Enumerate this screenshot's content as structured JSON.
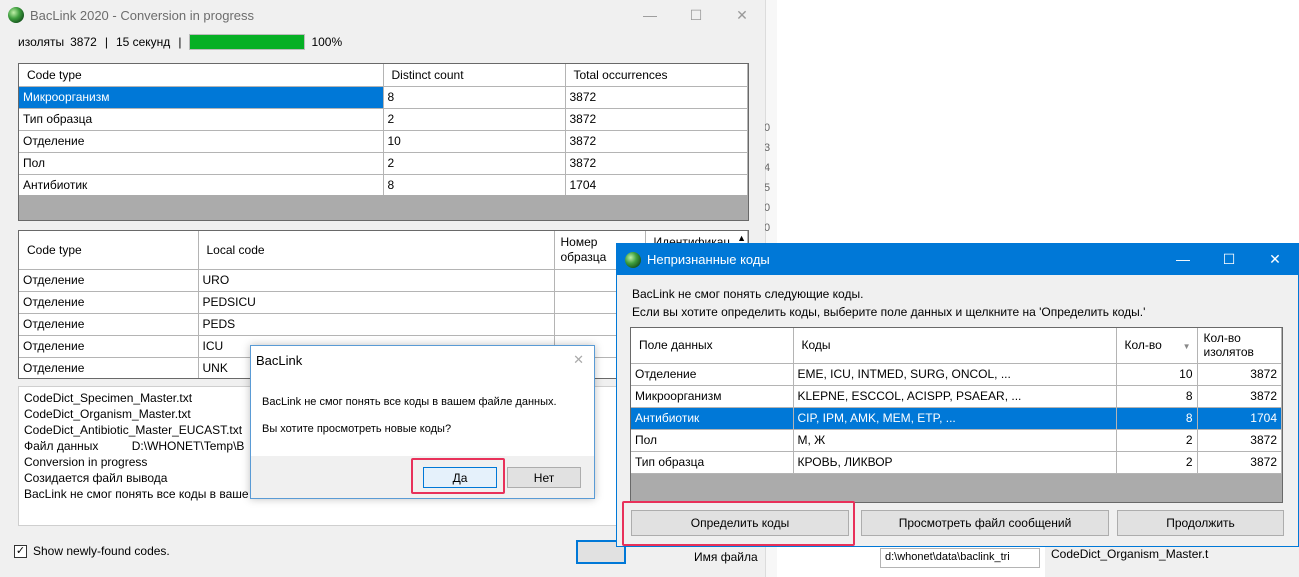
{
  "main": {
    "title": "BacLink 2020 - Conversion in progress",
    "status": {
      "isolates_label": "изоляты",
      "isolates_count": "3872",
      "sep1": "|",
      "time": "15 секунд",
      "sep2": "|",
      "progress": 100,
      "progress_text": "100%"
    },
    "summary_table": {
      "headers": [
        "Code type",
        "Distinct count",
        "Total occurrences"
      ],
      "rows": [
        [
          "Микроорганизм",
          "8",
          "3872"
        ],
        [
          "Тип образца",
          "2",
          "3872"
        ],
        [
          "Отделение",
          "10",
          "3872"
        ],
        [
          "Пол",
          "2",
          "3872"
        ],
        [
          "Антибиотик",
          "8",
          "1704"
        ]
      ]
    },
    "codes_table": {
      "headers": [
        "Code type",
        "Local code",
        "Номер образца",
        "Идентификац"
      ],
      "rows": [
        [
          "Отделение",
          "URO"
        ],
        [
          "Отделение",
          "PEDSICU"
        ],
        [
          "Отделение",
          "PEDS"
        ],
        [
          "Отделение",
          "ICU"
        ],
        [
          "Отделение",
          "UNK"
        ]
      ]
    },
    "log_lines": [
      "CodeDict_Specimen_Master.txt",
      "CodeDict_Organism_Master.txt",
      "CodeDict_Antibiotic_Master_EUCAST.txt",
      "Файл данных          D:\\WHONET\\Temp\\B",
      "Conversion in progress",
      "Созидается файл вывода",
      "BacLink не смог понять все коды в ваше"
    ],
    "show_codes_label": "Show newly-found codes.",
    "file_name_label": "Имя файла",
    "file_path": "d:\\whonet\\data\\baclink_tri",
    "bg_right_text": "CodeDict_Organism_Master.t",
    "bg_edge_digits": [
      "0",
      "3",
      "4",
      "5",
      "0",
      "0"
    ]
  },
  "dialog": {
    "title": "BacLink",
    "message1": "BacLink не смог понять все коды в вашем файле данных.",
    "message2": "Вы хотите просмотреть новые коды?",
    "yes": "Да",
    "no": "Нет"
  },
  "unrec": {
    "title": "Непризнанные коды",
    "info1": "BacLink не смог понять следующие коды.",
    "info2": "Если вы хотите определить коды, выберите поле данных и щелкните на 'Определить коды.'",
    "headers": [
      "Поле данных",
      "Коды",
      "Кол-во",
      "Кол-во изолятов"
    ],
    "rows": [
      [
        "Отделение",
        "EME, ICU, INTMED, SURG, ONCOL, ...",
        "10",
        "3872"
      ],
      [
        "Микроорганизм",
        "KLEPNE, ESCCOL, ACISPP, PSAEAR, ...",
        "8",
        "3872"
      ],
      [
        "Антибиотик",
        "CIP, IPM, AMK, MEM, ETP, ...",
        "8",
        "1704"
      ],
      [
        "Пол",
        "M, Ж",
        "2",
        "3872"
      ],
      [
        "Тип образца",
        "КРОВЬ, ЛИКВОР",
        "2",
        "3872"
      ]
    ],
    "buttons": {
      "define": "Определить коды",
      "view_log": "Просмотреть файл сообщений",
      "continue": "Продолжить"
    }
  },
  "colors": {
    "accent": "#0078d7",
    "progress": "#06b025",
    "highlight": "#e8315a"
  }
}
